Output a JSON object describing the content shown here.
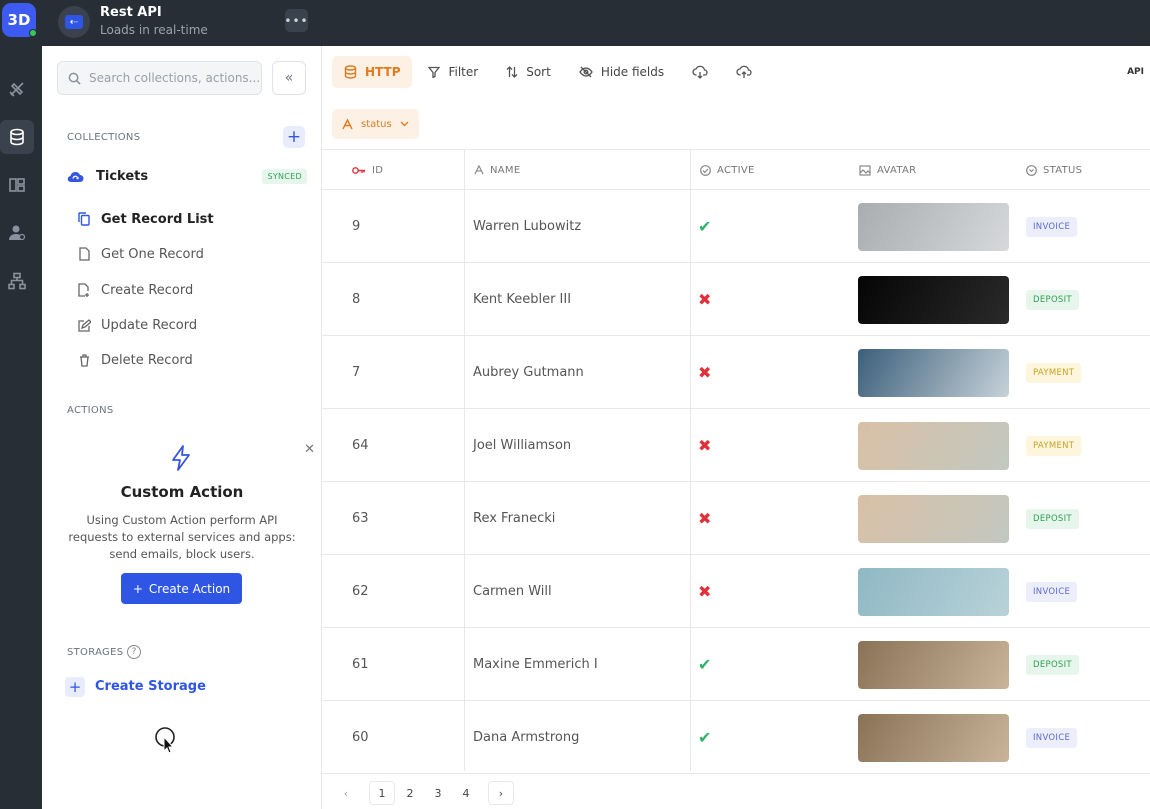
{
  "app": {
    "logo_text": "3D",
    "title": "Rest API",
    "subtitle": "Loads in real-time",
    "more": "•••"
  },
  "rail": {
    "icons": [
      "design-icon",
      "database-icon",
      "layout-icon",
      "users-icon",
      "sitemap-icon"
    ],
    "active": "database-icon"
  },
  "sidebar": {
    "search_placeholder": "Search collections, actions...",
    "collapse": "«",
    "collections_label": "COLLECTIONS",
    "add": "+",
    "collection": {
      "name": "Tickets",
      "badge": "SYNCED"
    },
    "items": [
      {
        "label": "Get Record List",
        "icon": "copy-icon"
      },
      {
        "label": "Get One Record",
        "icon": "file-icon"
      },
      {
        "label": "Create Record",
        "icon": "file-plus-icon"
      },
      {
        "label": "Update Record",
        "icon": "edit-icon"
      },
      {
        "label": "Delete Record",
        "icon": "trash-icon"
      }
    ],
    "actions_label": "ACTIONS",
    "action_card": {
      "title": "Custom Action",
      "desc": "Using Custom Action perform API requests to external services and apps: send emails, block users.",
      "button": "Create Action",
      "button_plus": "+",
      "close": "✕"
    },
    "storages_label": "STORAGES",
    "help": "?",
    "storage_plus": "+",
    "create_storage": "Create Storage"
  },
  "toolbar": {
    "http": "HTTP",
    "filter": "Filter",
    "sort": "Sort",
    "hide_fields": "Hide fields",
    "api": "API"
  },
  "chip": {
    "label": "status"
  },
  "table": {
    "headers": {
      "id": "ID",
      "name": "NAME",
      "active": "ACTIVE",
      "avatar": "AVATAR",
      "status": "STATUS"
    },
    "rows": [
      {
        "id": "9",
        "name": "Warren Lubowitz",
        "active": "✔",
        "active_ok": true,
        "status": "INVOICE",
        "avatar_colors": [
          "#a9adb0",
          "#d6d8da"
        ]
      },
      {
        "id": "8",
        "name": "Kent Keebler III",
        "active": "✖",
        "active_ok": false,
        "status": "DEPOSIT",
        "avatar_colors": [
          "#050505",
          "#2a2a2a"
        ]
      },
      {
        "id": "7",
        "name": "Aubrey Gutmann",
        "active": "✖",
        "active_ok": false,
        "status": "PAYMENT",
        "avatar_colors": [
          "#3b5f7a",
          "#c7d2d9"
        ]
      },
      {
        "id": "64",
        "name": "Joel Williamson",
        "active": "✖",
        "active_ok": false,
        "status": "PAYMENT",
        "avatar_colors": [
          "#d9c0a6",
          "#c2c8c0"
        ]
      },
      {
        "id": "63",
        "name": "Rex Franecki",
        "active": "✖",
        "active_ok": false,
        "status": "DEPOSIT",
        "avatar_colors": [
          "#d9c0a6",
          "#c2c8c0"
        ]
      },
      {
        "id": "62",
        "name": "Carmen Will",
        "active": "✖",
        "active_ok": false,
        "status": "INVOICE",
        "avatar_colors": [
          "#8fb8c4",
          "#b9d2d8"
        ]
      },
      {
        "id": "61",
        "name": "Maxine Emmerich I",
        "active": "✔",
        "active_ok": true,
        "status": "DEPOSIT",
        "avatar_colors": [
          "#8a7256",
          "#c9b49a"
        ]
      },
      {
        "id": "60",
        "name": "Dana Armstrong",
        "active": "✔",
        "active_ok": true,
        "status": "INVOICE",
        "avatar_colors": [
          "#8a7256",
          "#c9b49a"
        ]
      }
    ]
  },
  "status_colors": {
    "INVOICE": {
      "bg": "#eceefb",
      "fg": "#5b6ad0"
    },
    "DEPOSIT": {
      "bg": "#e7f6ec",
      "fg": "#2f9e55"
    },
    "PAYMENT": {
      "bg": "#fdf6dd",
      "fg": "#c9a227"
    }
  },
  "pager": {
    "prev": "‹",
    "pages": [
      "1",
      "2",
      "3",
      "4"
    ],
    "current": "1",
    "next": "›"
  },
  "colors": {
    "accent": "#2f55e4",
    "orange": "#e07a1f",
    "dark": "#272e35"
  }
}
